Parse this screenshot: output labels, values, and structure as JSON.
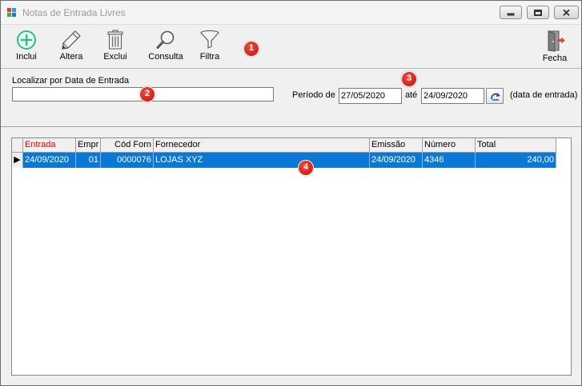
{
  "window": {
    "title": "Notas de Entrada Livres",
    "buttons": {
      "minimize": "minimize",
      "maximize": "maximize",
      "close": "close"
    }
  },
  "toolbar": {
    "items": [
      {
        "label": "Inclui",
        "icon": "plus-circle-icon"
      },
      {
        "label": "Altera",
        "icon": "pencil-icon"
      },
      {
        "label": "Exclui",
        "icon": "trash-icon"
      },
      {
        "label": "Consulta",
        "icon": "magnifier-icon"
      },
      {
        "label": "Filtra",
        "icon": "funnel-icon"
      },
      {
        "label": "Fecha",
        "icon": "exit-door-icon"
      }
    ]
  },
  "filter": {
    "localizar_label": "Localizar por Data de Entrada",
    "localizar_value": "",
    "periodo_label": "Período de",
    "date_start": "27/05/2020",
    "ate_label": "até",
    "date_end": "24/09/2020",
    "data_entrada_label": "(data de entrada)"
  },
  "callouts": [
    "1",
    "2",
    "3",
    "4"
  ],
  "grid": {
    "columns": [
      "Entrada",
      "Empr",
      "Cód Forn",
      "Fornecedor",
      "Emissão",
      "Número",
      "Total"
    ],
    "rows": [
      {
        "entrada": "24/09/2020",
        "empr": "01",
        "cod_forn": "0000076",
        "fornecedor": "LOJAS XYZ",
        "emissao": "24/09/2020",
        "numero": "4346",
        "total": "240,00",
        "selected": true
      }
    ]
  },
  "colors": {
    "selection": "#0a78d7",
    "sorted_column_header": "#e00000",
    "callout_badge": "#d8261b"
  }
}
